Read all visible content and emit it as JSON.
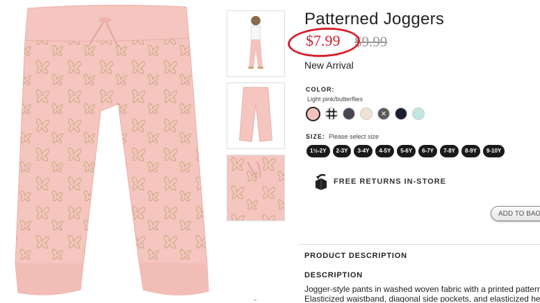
{
  "product": {
    "title": "Patterned Joggers",
    "sale_price": "$7.99",
    "original_price": "$9.99",
    "badge": "New Arrival"
  },
  "color": {
    "label": "COLOR:",
    "selected_name": "Light pink/butterflies",
    "swatches": [
      "#f3c2bd",
      "#2b2b2b",
      "#4a4450",
      "#efe2d2",
      "#5a5a5a",
      "#1b1f33",
      "#bfe8e2"
    ]
  },
  "size": {
    "label": "SIZE:",
    "hint": "Please select size",
    "options": [
      "1½-2Y",
      "2-3Y",
      "3-4Y",
      "4-5Y",
      "5-6Y",
      "6-7Y",
      "7-8Y",
      "8-9Y",
      "9-10Y"
    ]
  },
  "returns": {
    "label": "FREE RETURNS IN-STORE",
    "icon": "box-arrow-icon"
  },
  "cart": {
    "add_label": "ADD TO BAG"
  },
  "description": {
    "section_heading": "PRODUCT DESCRIPTION",
    "heading": "DESCRIPTION",
    "line1": "Jogger-style pants in washed woven fabric with a printed pattern.",
    "line2": "Elasticized waistband, diagonal side pockets, and elasticized hems."
  },
  "colors": {
    "accent_red": "#c82233",
    "pant_pink": "#f5c5c0",
    "butterfly_gold": "#c8a97e"
  }
}
